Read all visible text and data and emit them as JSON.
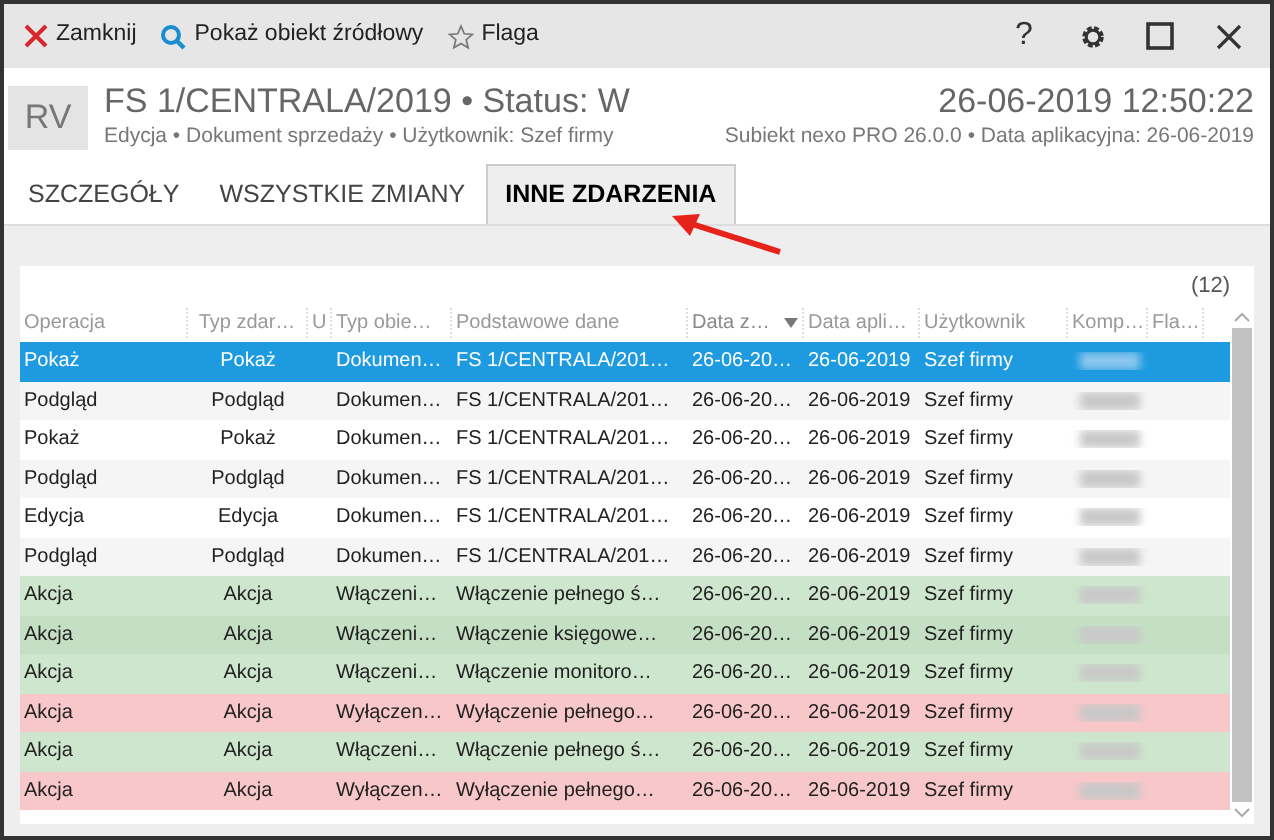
{
  "toolbar": {
    "left": [
      {
        "kind": "close",
        "label": "Zamknij"
      },
      {
        "kind": "search",
        "label": "Pokaż obiekt źródłowy"
      },
      {
        "kind": "star",
        "label": "Flaga"
      }
    ],
    "right": [
      {
        "kind": "help",
        "label": "?"
      },
      {
        "kind": "settings"
      },
      {
        "kind": "maximize"
      },
      {
        "kind": "close"
      }
    ]
  },
  "header": {
    "avatar": "RV",
    "title": "FS 1/CENTRALA/2019 • Status: W",
    "meta": "Edycja • Dokument sprzedaży • Użytkownik: Szef firmy",
    "datetime": "26-06-2019 12:50:22",
    "app_meta": "Subiekt nexo PRO 26.0.0 • Data aplikacyjna: 26-06-2019"
  },
  "tabs": [
    {
      "label": "SZCZEGÓŁY",
      "selected": false
    },
    {
      "label": "WSZYSTKIE ZMIANY",
      "selected": false
    },
    {
      "label": "INNE ZDARZENIA",
      "selected": true
    }
  ],
  "count": "(12)",
  "table": {
    "columns": [
      {
        "label": "Operacja",
        "sorted": false
      },
      {
        "label": "Typ zdar…",
        "sorted": false
      },
      {
        "label": "U",
        "sorted": false
      },
      {
        "label": "Typ obie…",
        "sorted": false
      },
      {
        "label": "Podstawowe dane",
        "sorted": false
      },
      {
        "label": "Data z…",
        "sorted": true
      },
      {
        "label": "Data apli…",
        "sorted": false
      },
      {
        "label": "Użytkownik",
        "sorted": false
      },
      {
        "label": "Komp…",
        "sorted": false
      },
      {
        "label": "Fla…",
        "sorted": false
      }
    ],
    "rows": [
      {
        "kind": "normal",
        "selected": true,
        "cells": [
          "Pokaż",
          "Pokaż",
          "",
          "Dokumen…",
          "FS 1/CENTRALA/201…",
          "26-06-20…",
          "26-06-2019",
          "Szef firmy"
        ]
      },
      {
        "kind": "normal",
        "selected": false,
        "cells": [
          "Podgląd",
          "Podgląd",
          "",
          "Dokumen…",
          "FS 1/CENTRALA/201…",
          "26-06-20…",
          "26-06-2019",
          "Szef firmy"
        ]
      },
      {
        "kind": "normal",
        "selected": false,
        "cells": [
          "Pokaż",
          "Pokaż",
          "",
          "Dokumen…",
          "FS 1/CENTRALA/201…",
          "26-06-20…",
          "26-06-2019",
          "Szef firmy"
        ]
      },
      {
        "kind": "normal",
        "selected": false,
        "cells": [
          "Podgląd",
          "Podgląd",
          "",
          "Dokumen…",
          "FS 1/CENTRALA/201…",
          "26-06-20…",
          "26-06-2019",
          "Szef firmy"
        ]
      },
      {
        "kind": "normal",
        "selected": false,
        "cells": [
          "Edycja",
          "Edycja",
          "",
          "Dokumen…",
          "FS 1/CENTRALA/201…",
          "26-06-20…",
          "26-06-2019",
          "Szef firmy"
        ]
      },
      {
        "kind": "normal",
        "selected": false,
        "cells": [
          "Podgląd",
          "Podgląd",
          "",
          "Dokumen…",
          "FS 1/CENTRALA/201…",
          "26-06-20…",
          "26-06-2019",
          "Szef firmy"
        ]
      },
      {
        "kind": "enabled",
        "selected": false,
        "cells": [
          "Akcja",
          "Akcja",
          "",
          "Włączeni…",
          "Włączenie pełnego ś…",
          "26-06-20…",
          "26-06-2019",
          "Szef firmy"
        ]
      },
      {
        "kind": "enabled",
        "selected": false,
        "cells": [
          "Akcja",
          "Akcja",
          "",
          "Włączeni…",
          "Włączenie księgowe…",
          "26-06-20…",
          "26-06-2019",
          "Szef firmy"
        ]
      },
      {
        "kind": "enabled",
        "selected": false,
        "cells": [
          "Akcja",
          "Akcja",
          "",
          "Włączeni…",
          "Włączenie monitoro…",
          "26-06-20…",
          "26-06-2019",
          "Szef firmy"
        ]
      },
      {
        "kind": "disabled",
        "selected": false,
        "cells": [
          "Akcja",
          "Akcja",
          "",
          "Wyłączen…",
          "Wyłączenie pełnego…",
          "26-06-20…",
          "26-06-2019",
          "Szef firmy"
        ]
      },
      {
        "kind": "enabled",
        "selected": false,
        "cells": [
          "Akcja",
          "Akcja",
          "",
          "Włączeni…",
          "Włączenie pełnego ś…",
          "26-06-20…",
          "26-06-2019",
          "Szef firmy"
        ]
      },
      {
        "kind": "disabled",
        "selected": false,
        "cells": [
          "Akcja",
          "Akcja",
          "",
          "Wyłączen…",
          "Wyłączenie pełnego…",
          "26-06-20…",
          "26-06-2019",
          "Szef firmy"
        ]
      }
    ]
  }
}
